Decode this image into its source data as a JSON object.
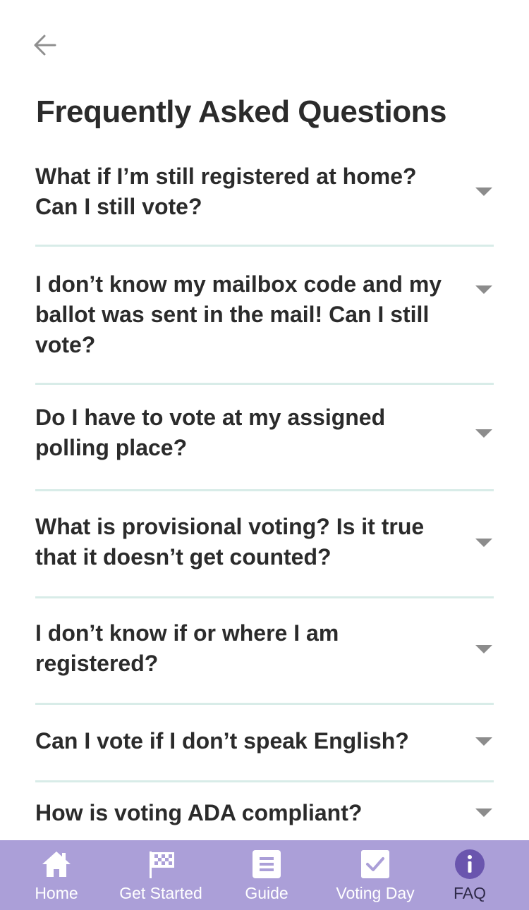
{
  "page": {
    "title": "Frequently Asked Questions"
  },
  "faq": [
    {
      "question": "What if I’m still registered at home? Can I still vote?"
    },
    {
      "question": "I don’t know my mailbox code and my ballot was sent in the mail! Can I still vote?"
    },
    {
      "question": "Do I have to vote at my assigned polling place?"
    },
    {
      "question": "What is provisional voting? Is it true that it doesn’t get counted?"
    },
    {
      "question": "I don’t know if or where I am registered?"
    },
    {
      "question": "Can I vote if I don’t speak English?"
    },
    {
      "question": "How is voting ADA compliant?"
    }
  ],
  "tabbar": {
    "tabs": [
      {
        "label": "Home",
        "icon": "home-icon"
      },
      {
        "label": "Get Started",
        "icon": "checkered-flag-icon"
      },
      {
        "label": "Guide",
        "icon": "guide-list-icon"
      },
      {
        "label": "Voting Day",
        "icon": "checkbox-icon"
      },
      {
        "label": "FAQ",
        "icon": "info-icon",
        "active": true
      }
    ]
  },
  "colors": {
    "tabbar_bg": "#ab9fd8",
    "divider": "#d8ece8",
    "active_tab": "#6a55ae",
    "text": "#2b2b2b"
  }
}
